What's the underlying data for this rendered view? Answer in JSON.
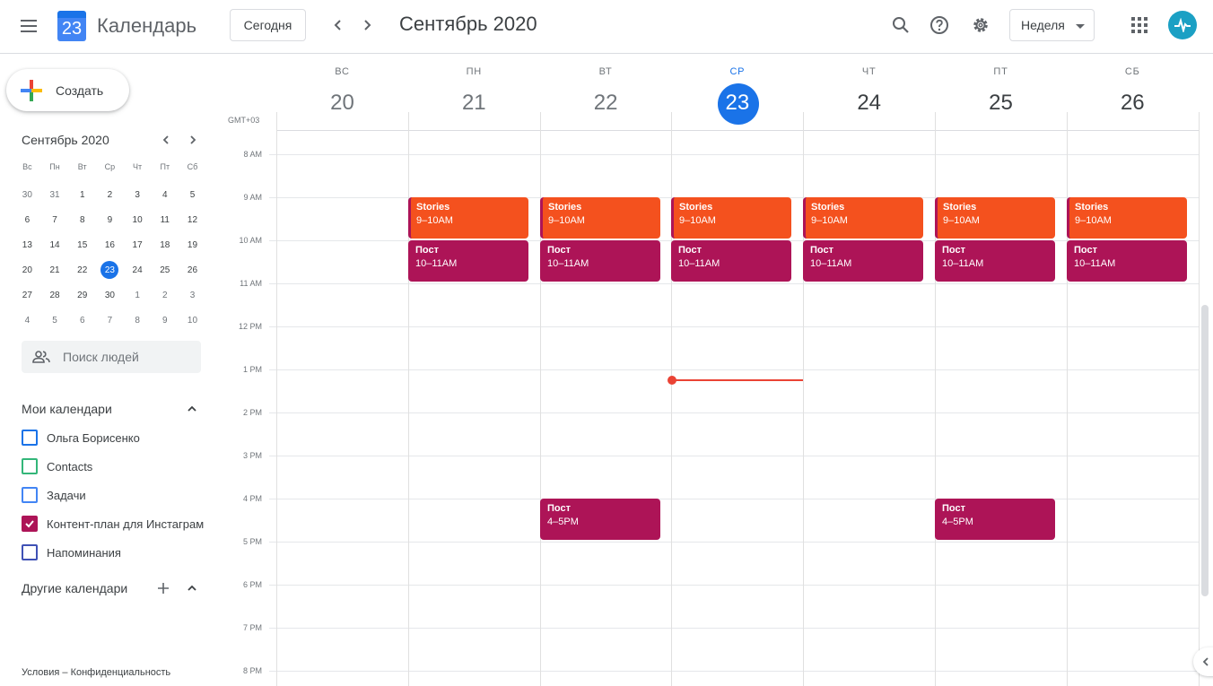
{
  "header": {
    "menu_icon": "hamburger-menu-icon",
    "logo_day": "23",
    "app_title": "Календарь",
    "today_label": "Сегодня",
    "month_title": "Сентябрь 2020",
    "view_label": "Неделя",
    "icons": [
      "search-icon",
      "help-icon",
      "gear-icon",
      "apps-grid-icon"
    ]
  },
  "sidebar": {
    "create_label": "Создать",
    "mini_calendar": {
      "title": "Сентябрь 2020",
      "weekdays": [
        "Вс",
        "Пн",
        "Вт",
        "Ср",
        "Чт",
        "Пт",
        "Сб"
      ],
      "weeks": [
        [
          "30",
          "31",
          "1",
          "2",
          "3",
          "4",
          "5"
        ],
        [
          "6",
          "7",
          "8",
          "9",
          "10",
          "11",
          "12"
        ],
        [
          "13",
          "14",
          "15",
          "16",
          "17",
          "18",
          "19"
        ],
        [
          "20",
          "21",
          "22",
          "23",
          "24",
          "25",
          "26"
        ],
        [
          "27",
          "28",
          "29",
          "30",
          "1",
          "2",
          "3"
        ],
        [
          "4",
          "5",
          "6",
          "7",
          "8",
          "9",
          "10"
        ]
      ],
      "today": "23"
    },
    "people_search_placeholder": "Поиск людей",
    "my_calendars_title": "Мои календари",
    "my_calendars": [
      {
        "name": "Ольга Борисенко",
        "color": "#1a73e8",
        "checked": false
      },
      {
        "name": "Contacts",
        "color": "#33b679",
        "checked": false
      },
      {
        "name": "Задачи",
        "color": "#4285f4",
        "checked": false
      },
      {
        "name": "Контент-план для Инстаграм",
        "color": "#ad1457",
        "checked": true
      },
      {
        "name": "Напоминания",
        "color": "#3f51b5",
        "checked": false
      }
    ],
    "other_calendars_title": "Другие календари",
    "footer": "Условия – Конфиденциальность"
  },
  "week": {
    "timezone": "GMT+03",
    "days": [
      {
        "dow": "ВС",
        "num": "20"
      },
      {
        "dow": "ПН",
        "num": "21"
      },
      {
        "dow": "ВТ",
        "num": "22"
      },
      {
        "dow": "СР",
        "num": "23"
      },
      {
        "dow": "ЧТ",
        "num": "24"
      },
      {
        "dow": "ПТ",
        "num": "25"
      },
      {
        "dow": "СБ",
        "num": "26"
      }
    ],
    "hours": [
      "8 AM",
      "9 AM",
      "10 AM",
      "11 AM",
      "12 PM",
      "1 PM",
      "2 PM",
      "3 PM",
      "4 PM",
      "5 PM",
      "6 PM",
      "7 PM",
      "8 PM"
    ],
    "events": {
      "stories_title": "Stories",
      "stories_time": "9–10AM",
      "post_title": "Пост",
      "post_morning_time": "10–11AM",
      "post_afternoon_time": "4–5PM"
    },
    "colors": {
      "stories": "#f4511e",
      "post": "#ad1457",
      "today_accent": "#1a73e8",
      "now_line": "#ea4335"
    }
  }
}
